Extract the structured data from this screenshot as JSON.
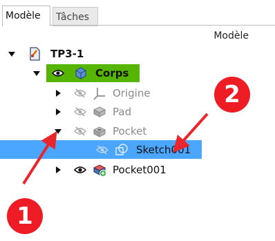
{
  "tabs": [
    {
      "label": "Modèle",
      "active": true
    },
    {
      "label": "Tâches",
      "active": false
    }
  ],
  "tree": {
    "header": "Modèle",
    "items": [
      {
        "label": "TP3-1",
        "depth": 0,
        "expanded": true,
        "icon": "document-icon",
        "visible": null
      },
      {
        "label": "Corps",
        "depth": 1,
        "expanded": true,
        "icon": "body-icon",
        "visible": true,
        "highlight": "#56b500"
      },
      {
        "label": "Origine",
        "depth": 2,
        "expanded": false,
        "icon": "origin-icon",
        "visible": false
      },
      {
        "label": "Pad",
        "depth": 2,
        "expanded": false,
        "icon": "pad-icon",
        "visible": false
      },
      {
        "label": "Pocket",
        "depth": 2,
        "expanded": true,
        "icon": "pocket-icon",
        "visible": false
      },
      {
        "label": "Sketch001",
        "depth": 3,
        "expanded": null,
        "icon": "sketch-icon",
        "visible": false,
        "selected": true
      },
      {
        "label": "Pocket001",
        "depth": 2,
        "expanded": false,
        "icon": "pocket-tip-icon",
        "visible": true
      }
    ]
  },
  "annotations": [
    {
      "label": "1",
      "color": "#ee1c24"
    },
    {
      "label": "2",
      "color": "#ee1c24"
    }
  ],
  "colors": {
    "selection": "#4aa6ff",
    "highlight": "#56b500",
    "marker": "#ee1c24"
  }
}
